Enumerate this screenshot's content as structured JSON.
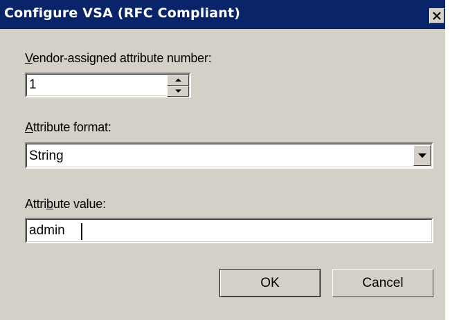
{
  "window": {
    "title": "Configure VSA (RFC Compliant)",
    "close_icon": "close-icon"
  },
  "vendor_attribute": {
    "label_mnemonic": "V",
    "label_rest": "endor-assigned attribute number:",
    "value": "1",
    "spin_up_icon": "chevron-up-icon",
    "spin_down_icon": "chevron-down-icon"
  },
  "attribute_format": {
    "label_mnemonic": "A",
    "label_rest": "ttribute format:",
    "selected": "String",
    "dropdown_icon": "chevron-down-icon"
  },
  "attribute_value": {
    "label_before": "Attri",
    "label_mnemonic": "b",
    "label_after": "ute value:",
    "value": "admin"
  },
  "buttons": {
    "ok": "OK",
    "cancel": "Cancel"
  },
  "colors": {
    "titlebar": "#0a246a",
    "dialog_face": "#d4d0c8",
    "field_bg": "#ffffff"
  }
}
